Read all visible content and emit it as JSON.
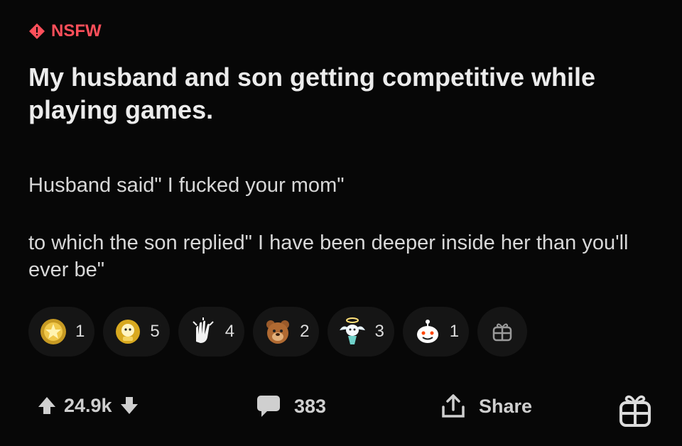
{
  "post": {
    "nsfw_label": "NSFW",
    "title": "My husband and son getting competitive while playing games.",
    "paragraphs": [
      "Husband said\" I fucked your mom\"",
      "to which the son replied\" I have been deeper inside her than you'll ever be\""
    ]
  },
  "awards": [
    {
      "icon": "gold-star-award-icon",
      "count": "1"
    },
    {
      "icon": "helpful-award-icon",
      "count": "5"
    },
    {
      "icon": "applause-hands-award-icon",
      "count": "4"
    },
    {
      "icon": "bear-award-icon",
      "count": "2"
    },
    {
      "icon": "angel-award-icon",
      "count": "3"
    },
    {
      "icon": "snoo-award-icon",
      "count": "1"
    }
  ],
  "actions": {
    "score": "24.9k",
    "comments": "383",
    "share_label": "Share"
  },
  "colors": {
    "background": "#070707",
    "nsfw": "#ff4f5a",
    "text": "#e9e9e9"
  }
}
